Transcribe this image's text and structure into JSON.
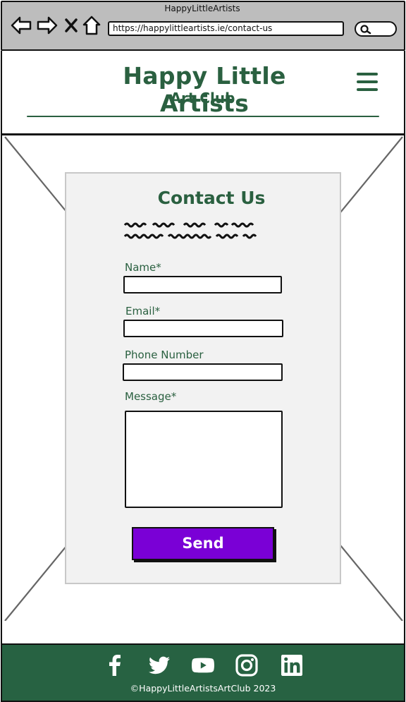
{
  "window": {
    "title": "HappyLittleArtists"
  },
  "browser": {
    "url": "https://happylittleartists.ie/contact-us"
  },
  "header": {
    "title": "Happy Little Artists",
    "subtitle": "Art Club"
  },
  "form": {
    "title": "Contact Us",
    "fields": {
      "name_label": "Name*",
      "email_label": "Email*",
      "phone_label": "Phone Number",
      "message_label": "Message*"
    },
    "send_label": "Send"
  },
  "footer": {
    "social": [
      "facebook-icon",
      "twitter-icon",
      "youtube-icon",
      "instagram-icon",
      "linkedin-icon"
    ],
    "copyright": "©HappyLittleArtistsArtClub 2023"
  },
  "colors": {
    "brand_green": "#2a6040",
    "footer_green": "#276242",
    "send_purple": "#7a00d6"
  }
}
